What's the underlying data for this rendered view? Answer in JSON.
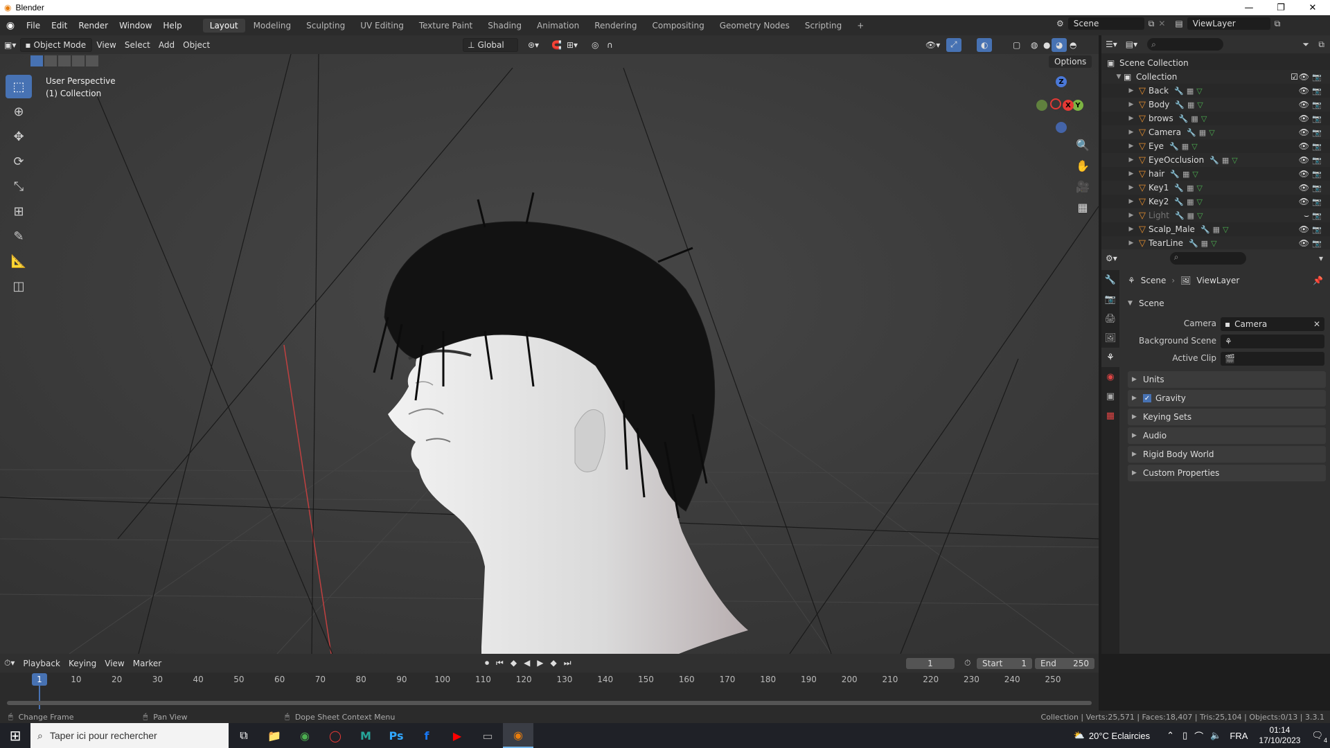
{
  "window": {
    "title": "Blender"
  },
  "menubar": {
    "items": [
      "File",
      "Edit",
      "Render",
      "Window",
      "Help"
    ]
  },
  "workspaces": {
    "tabs": [
      "Layout",
      "Modeling",
      "Sculpting",
      "UV Editing",
      "Texture Paint",
      "Shading",
      "Animation",
      "Rendering",
      "Compositing",
      "Geometry Nodes",
      "Scripting"
    ],
    "active": "Layout",
    "add": "+"
  },
  "scene_selector": {
    "label": "Scene"
  },
  "viewlayer_selector": {
    "label": "ViewLayer"
  },
  "viewport_header": {
    "mode": "Object Mode",
    "menus": [
      "View",
      "Select",
      "Add",
      "Object"
    ],
    "transform": "Global",
    "options": "Options"
  },
  "viewport": {
    "line1": "User Perspective",
    "line2": "(1) Collection"
  },
  "gizmo": {
    "x": "X",
    "y": "Y",
    "z": "Z"
  },
  "outliner": {
    "root": "Scene Collection",
    "collection": "Collection",
    "items": [
      {
        "name": "Back"
      },
      {
        "name": "Body"
      },
      {
        "name": "brows"
      },
      {
        "name": "Camera"
      },
      {
        "name": "Eye"
      },
      {
        "name": "EyeOcclusion"
      },
      {
        "name": "hair"
      },
      {
        "name": "Key1"
      },
      {
        "name": "Key2"
      },
      {
        "name": "Light"
      },
      {
        "name": "Scalp_Male"
      },
      {
        "name": "TearLine"
      }
    ]
  },
  "properties": {
    "breadcrumb": [
      "Scene",
      "ViewLayer"
    ],
    "section": "Scene",
    "camera_label": "Camera",
    "camera_value": "Camera",
    "background_label": "Background Scene",
    "clip_label": "Active Clip",
    "panels": [
      "Units",
      "Gravity",
      "Keying Sets",
      "Audio",
      "Rigid Body World",
      "Custom Properties"
    ]
  },
  "timeline": {
    "menus": [
      "Playback",
      "Keying",
      "View",
      "Marker"
    ],
    "current_frame": "1",
    "start_label": "Start",
    "start": "1",
    "end_label": "End",
    "end": "250",
    "ticks": [
      "1",
      "10",
      "20",
      "30",
      "40",
      "50",
      "60",
      "70",
      "80",
      "90",
      "100",
      "110",
      "120",
      "130",
      "140",
      "150",
      "160",
      "170",
      "180",
      "190",
      "200",
      "210",
      "220",
      "230",
      "240",
      "250"
    ]
  },
  "statusbar": {
    "left1": "Change Frame",
    "left2": "Pan View",
    "left3": "Dope Sheet Context Menu",
    "right": "Collection | Verts:25,571 | Faces:18,407 | Tris:25,104 | Objects:0/13 | 3.3.1"
  },
  "taskbar": {
    "search": "Taper ici pour rechercher",
    "weather": "20°C  Eclaircies",
    "lang": "FRA",
    "time": "01:14",
    "date": "17/10/2023",
    "notifications": "4"
  }
}
